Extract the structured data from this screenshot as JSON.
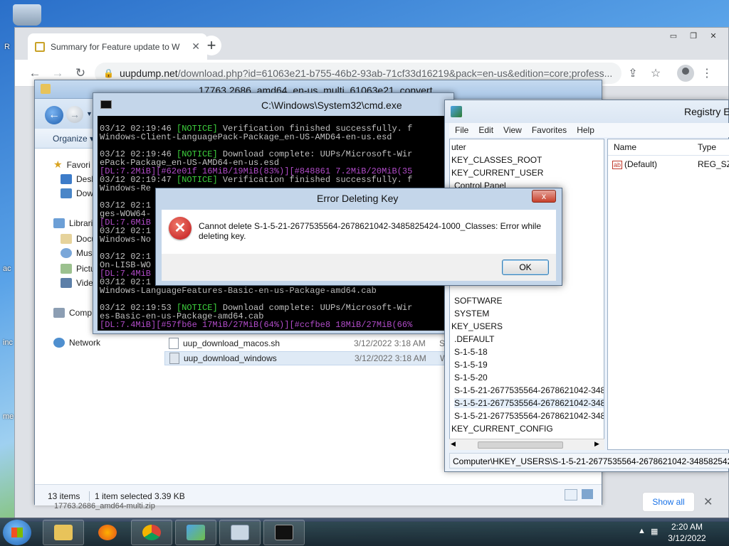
{
  "desktop": {
    "edge_labels": [
      "R",
      "ac",
      "inc",
      "me"
    ]
  },
  "chrome": {
    "tab_title": "Summary for Feature update to W",
    "new_tab_label": "+",
    "url_host": "uupdump.net",
    "url_path": "/download.php?id=61063e21-b755-46b2-93ab-71cf33d16219&pack=en-us&edition=core;profess..."
  },
  "explorer": {
    "title": "17763.2686_amd64_en-us_multi_61063e21_convert",
    "organize_label": "Organize ▾",
    "nav": [
      "Favori",
      "Desk",
      "Dow",
      "Librari",
      "Docu",
      "Mus",
      "Pictu",
      "Vide",
      "Comp",
      "Network"
    ],
    "files": [
      {
        "name": "uup_download_macos.sh",
        "date": "3/12/2022 3:18 AM",
        "type": "SH"
      },
      {
        "name": "uup_download_windows",
        "date": "3/12/2022 3:18 AM",
        "type": "W"
      }
    ],
    "status_count": "13 items",
    "status_selected": "1 item selected  3.39 KB",
    "zip_name": "17763.2686_amd64-multi.zip"
  },
  "cmd": {
    "title": "C:\\Windows\\System32\\cmd.exe",
    "lines": [
      "03/12 02:19:46 [NOTICE] Verification finished successfully. f",
      "Windows-Client-LanguagePack-Package_en-US-AMD64-en-us.esd",
      "",
      "03/12 02:19:46 [NOTICE] Download complete: UUPs/Microsoft-Wir",
      "ePack-Package_en-US-AMD64-en-us.esd",
      "[DL:7.2MiB][#62e01f 16MiB/19MiB(83%)][#848861 7.2MiB/20MiB(35",
      "03/12 02:19:47 [NOTICE] Verification finished successfully. f",
      "Windows-Re",
      "",
      "03/12 02:1",
      "ges-WOW64-",
      "[DL:7.6MiB",
      "03/12 02:1",
      "Windows-No",
      "",
      "03/12 02:1",
      "On-LISB-WO",
      "[DL:7.4MiB",
      "03/12 02:1",
      "Windows-LanguageFeatures-Basic-en-us-Package-amd64.cab",
      "",
      "03/12 02:19:53 [NOTICE] Download complete: UUPs/Microsoft-Wir",
      "es-Basic-en-us-Package-amd64.cab",
      "[DL:7.4MiB][#57fb6e 17MiB/27MiB(64%)][#ccfbe8 18MiB/27MiB(66%"
    ]
  },
  "regedit": {
    "title": "Registry E",
    "menu": [
      "File",
      "Edit",
      "View",
      "Favorites",
      "Help"
    ],
    "tree": [
      "uter",
      "KEY_CLASSES_ROOT",
      "KEY_CURRENT_USER",
      "Control Panel",
      "SOFTWARE",
      "SYSTEM",
      "KEY_USERS",
      ".DEFAULT",
      "S-1-5-18",
      "S-1-5-19",
      "S-1-5-20",
      "S-1-5-21-2677535564-2678621042-34858",
      "S-1-5-21-2677535564-2678621042-34858",
      "S-1-5-21-2677535564-2678621042-34858",
      "KEY_CURRENT_CONFIG"
    ],
    "col_name": "Name",
    "col_type": "Type",
    "value_name": "(Default)",
    "value_type": "REG_SZ",
    "status_path": "Computer\\HKEY_USERS\\S-1-5-21-2677535564-2678621042-3485825424-1000"
  },
  "dialog": {
    "title": "Error Deleting Key",
    "message": "Cannot delete S-1-5-21-2677535564-2678621042-3485825424-1000_Classes:  Error while deleting key.",
    "ok_label": "OK",
    "close_label": "x"
  },
  "download_bar": {
    "show_all_label": "Show all",
    "close_label": "✕"
  },
  "taskbar": {
    "time": "2:20 AM",
    "date": "3/12/2022"
  },
  "colors": {
    "console_notice": "#3ed43e",
    "console_progress": "#b04bc8",
    "dialog_error": "#c0161b"
  }
}
